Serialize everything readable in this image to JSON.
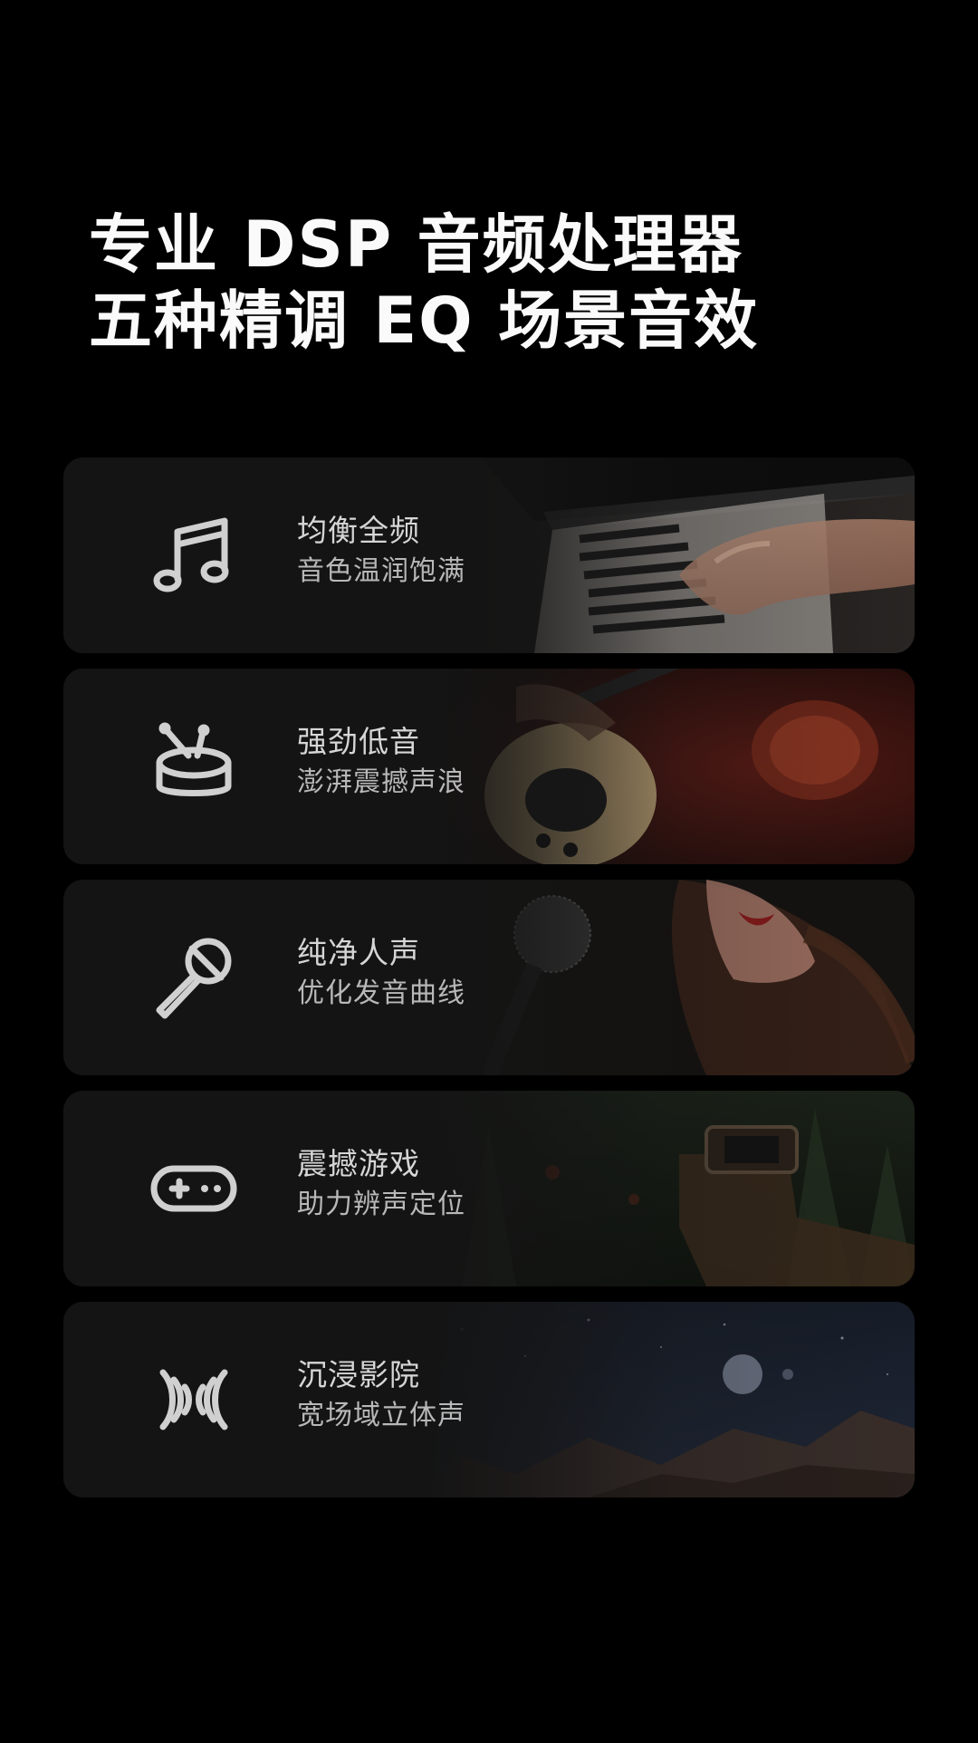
{
  "headline": {
    "line1": "专业 DSP 音频处理器",
    "line2": "五种精调 EQ 场景音效"
  },
  "modes": [
    {
      "icon": "music-note-icon",
      "title": "均衡全频",
      "subtitle": "音色温润饱满",
      "scene": "piano"
    },
    {
      "icon": "drum-icon",
      "title": "强劲低音",
      "subtitle": "澎湃震撼声浪",
      "scene": "guitar"
    },
    {
      "icon": "microphone-icon",
      "title": "纯净人声",
      "subtitle": "优化发音曲线",
      "scene": "singer"
    },
    {
      "icon": "gamepad-icon",
      "title": "震撼游戏",
      "subtitle": "助力辨声定位",
      "scene": "game"
    },
    {
      "icon": "surround-sound-icon",
      "title": "沉浸影院",
      "subtitle": "宽场域立体声",
      "scene": "space"
    }
  ],
  "colors": {
    "background": "#000000",
    "card": "#161616",
    "title_text": "#d6d6d6",
    "subtitle_text": "#b8b8b8"
  }
}
